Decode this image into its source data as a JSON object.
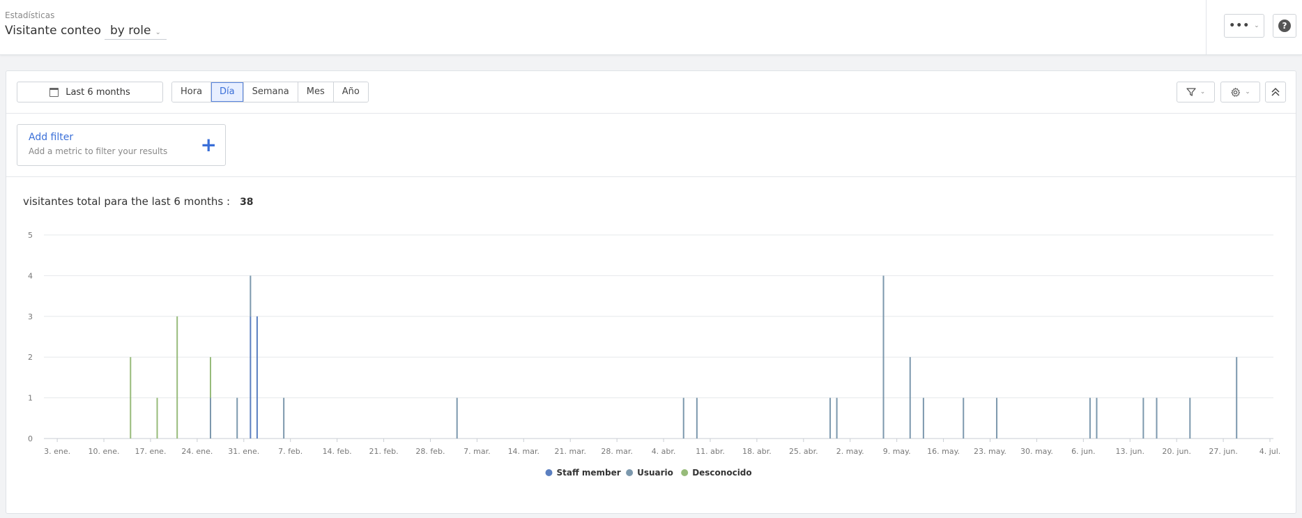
{
  "header": {
    "breadcrumb": "Estadísticas",
    "title": "Visitante conteo",
    "view_select": "by role",
    "more_icon": "ellipsis-icon",
    "help_icon": "help-icon"
  },
  "toolbar": {
    "date_range": "Last 6 months",
    "intervals": [
      "Hora",
      "Día",
      "Semana",
      "Mes",
      "Año"
    ],
    "active_interval": "Día"
  },
  "filter": {
    "title": "Add filter",
    "subtitle": "Add a metric to filter your results"
  },
  "summary": {
    "label": "visitantes total para the last 6 months :",
    "total": "38"
  },
  "chart_data": {
    "type": "bar",
    "ylim": [
      0,
      5
    ],
    "y_ticks": [
      "0",
      "1",
      "2",
      "3",
      "4",
      "5"
    ],
    "x_tick_labels": [
      "3. ene.",
      "10. ene.",
      "17. ene.",
      "24. ene.",
      "31. ene.",
      "7. feb.",
      "14. feb.",
      "21. feb.",
      "28. feb.",
      "7. mar.",
      "14. mar.",
      "21. mar.",
      "28. mar.",
      "4. abr.",
      "11. abr.",
      "18. abr.",
      "25. abr.",
      "2. may.",
      "9. may.",
      "16. may.",
      "23. may.",
      "30. may.",
      "6. jun.",
      "13. jun.",
      "20. jun.",
      "27. jun.",
      "4. jul."
    ],
    "x_start_label": "1. ene.",
    "grid": true,
    "legend_position": "bottom",
    "series": [
      {
        "name": "Staff member",
        "color": "#5b7fc0",
        "points": [
          [
            "1. feb.",
            3
          ],
          [
            "2. feb.",
            3
          ]
        ]
      },
      {
        "name": "Usuario",
        "color": "#7c98ad",
        "points": [
          [
            "26. ene.",
            1
          ],
          [
            "30. ene.",
            1
          ],
          [
            "1. feb.",
            1
          ],
          [
            "6. feb.",
            1
          ],
          [
            "4. mar.",
            1
          ],
          [
            "7. abr.",
            1
          ],
          [
            "9. abr.",
            1
          ],
          [
            "29. abr.",
            1
          ],
          [
            "30. abr.",
            1
          ],
          [
            "7. may.",
            4
          ],
          [
            "11. may.",
            2
          ],
          [
            "13. may.",
            1
          ],
          [
            "19. may.",
            1
          ],
          [
            "24. may.",
            1
          ],
          [
            "7. jun.",
            1
          ],
          [
            "8. jun.",
            1
          ],
          [
            "15. jun.",
            1
          ],
          [
            "17. jun.",
            1
          ],
          [
            "22. jun.",
            1
          ],
          [
            "29. jun.",
            2
          ]
        ]
      },
      {
        "name": "Desconocido",
        "color": "#97bb7a",
        "points": [
          [
            "14. ene.",
            2
          ],
          [
            "18. ene.",
            1
          ],
          [
            "21. ene.",
            3
          ],
          [
            "26. ene.",
            1
          ]
        ]
      }
    ]
  }
}
